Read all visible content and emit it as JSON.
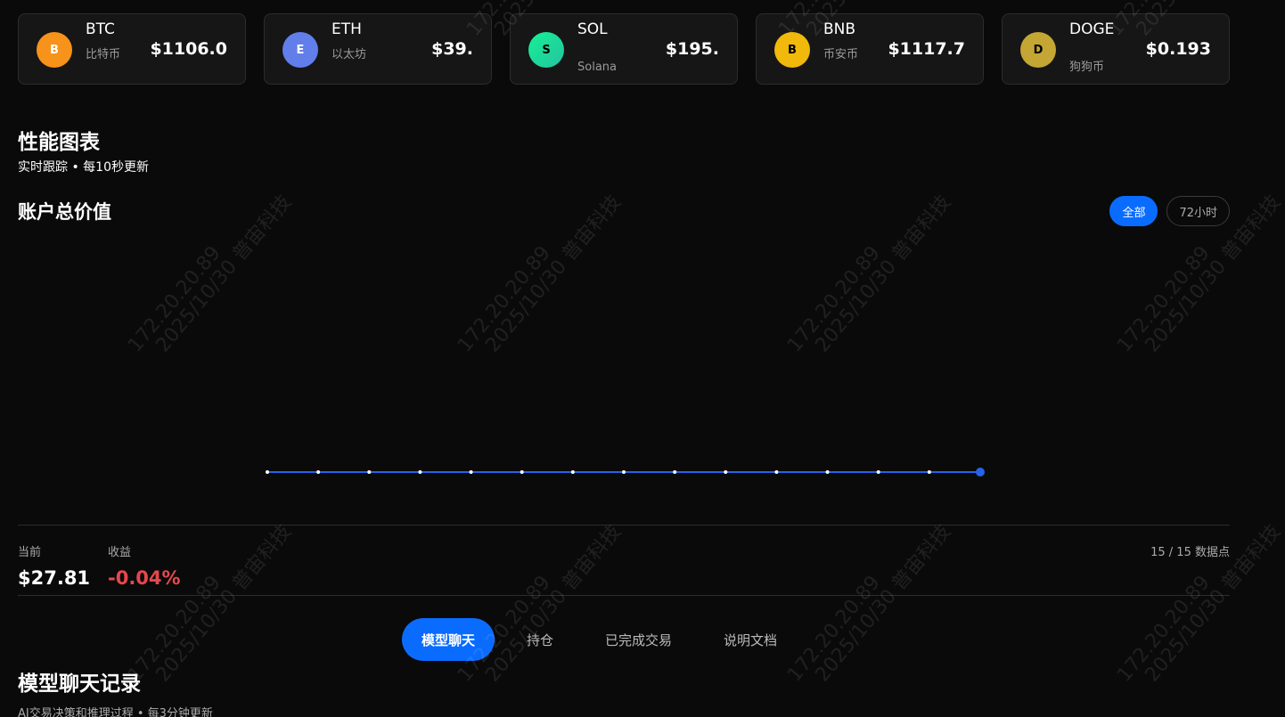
{
  "tickers": [
    {
      "symbol": "BTC",
      "name": "比特币",
      "price": "$1106.0",
      "badge": "B",
      "color": "#f7931a"
    },
    {
      "symbol": "ETH",
      "name": "以太坊",
      "price": "$39.",
      "badge": "E",
      "color": "#627eea"
    },
    {
      "symbol": "SOL",
      "name": "Solana",
      "price": "$195.",
      "badge": "S",
      "color": "#14f195"
    },
    {
      "symbol": "BNB",
      "name": "币安币",
      "price": "$1117.7",
      "badge": "B",
      "color": "#f0b90b"
    },
    {
      "symbol": "DOGE",
      "name": "狗狗币",
      "price": "$0.193",
      "badge": "D",
      "color": "#c3a634"
    }
  ],
  "performance": {
    "title": "性能图表",
    "subtitle": "实时跟踪 • 每10秒更新"
  },
  "account": {
    "title": "账户总价值",
    "range_all": "全部",
    "range_72h": "72小时",
    "current_label": "当前",
    "current_value": "$27.81",
    "return_label": "收益",
    "return_value": "-0.04%",
    "points_text": "15 / 15 数据点"
  },
  "chart_data": {
    "type": "line",
    "title": "账户总价值",
    "points": 15,
    "series": [
      {
        "values": [
          27.82,
          27.82,
          27.82,
          27.82,
          27.82,
          27.82,
          27.82,
          27.82,
          27.82,
          27.82,
          27.82,
          27.82,
          27.82,
          27.82,
          27.81
        ]
      }
    ],
    "grid": false,
    "color": "#2563eb"
  },
  "tabs": [
    "模型聊天",
    "持仓",
    "已完成交易",
    "说明文档"
  ],
  "chat": {
    "title": "模型聊天记录",
    "subtitle": "AI交易决策和推理过程 • 每3分钟更新"
  },
  "watermark": {
    "line1": "172.20.20.89",
    "line2": "2025/10/30 普宙科技"
  }
}
